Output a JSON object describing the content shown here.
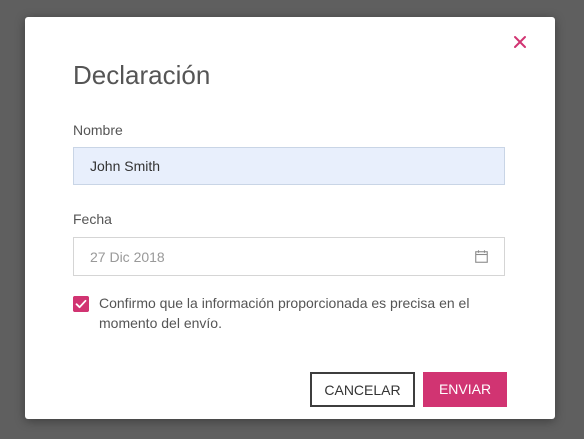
{
  "dialog": {
    "title": "Declaración",
    "close_icon": "close-icon"
  },
  "name_field": {
    "label": "Nombre",
    "value": "John Smith"
  },
  "date_field": {
    "label": "Fecha",
    "placeholder": "27 Dic 2018",
    "icon": "calendar-icon"
  },
  "confirm": {
    "checked": true,
    "label": "Confirmo que la información proporcionada es precisa en el momento del envío."
  },
  "actions": {
    "cancel_label": "CANCELAR",
    "submit_label": "ENVIAR"
  },
  "colors": {
    "accent": "#d13472",
    "overlay": "#5f5f5f",
    "filled_input_bg": "#e8effc"
  }
}
